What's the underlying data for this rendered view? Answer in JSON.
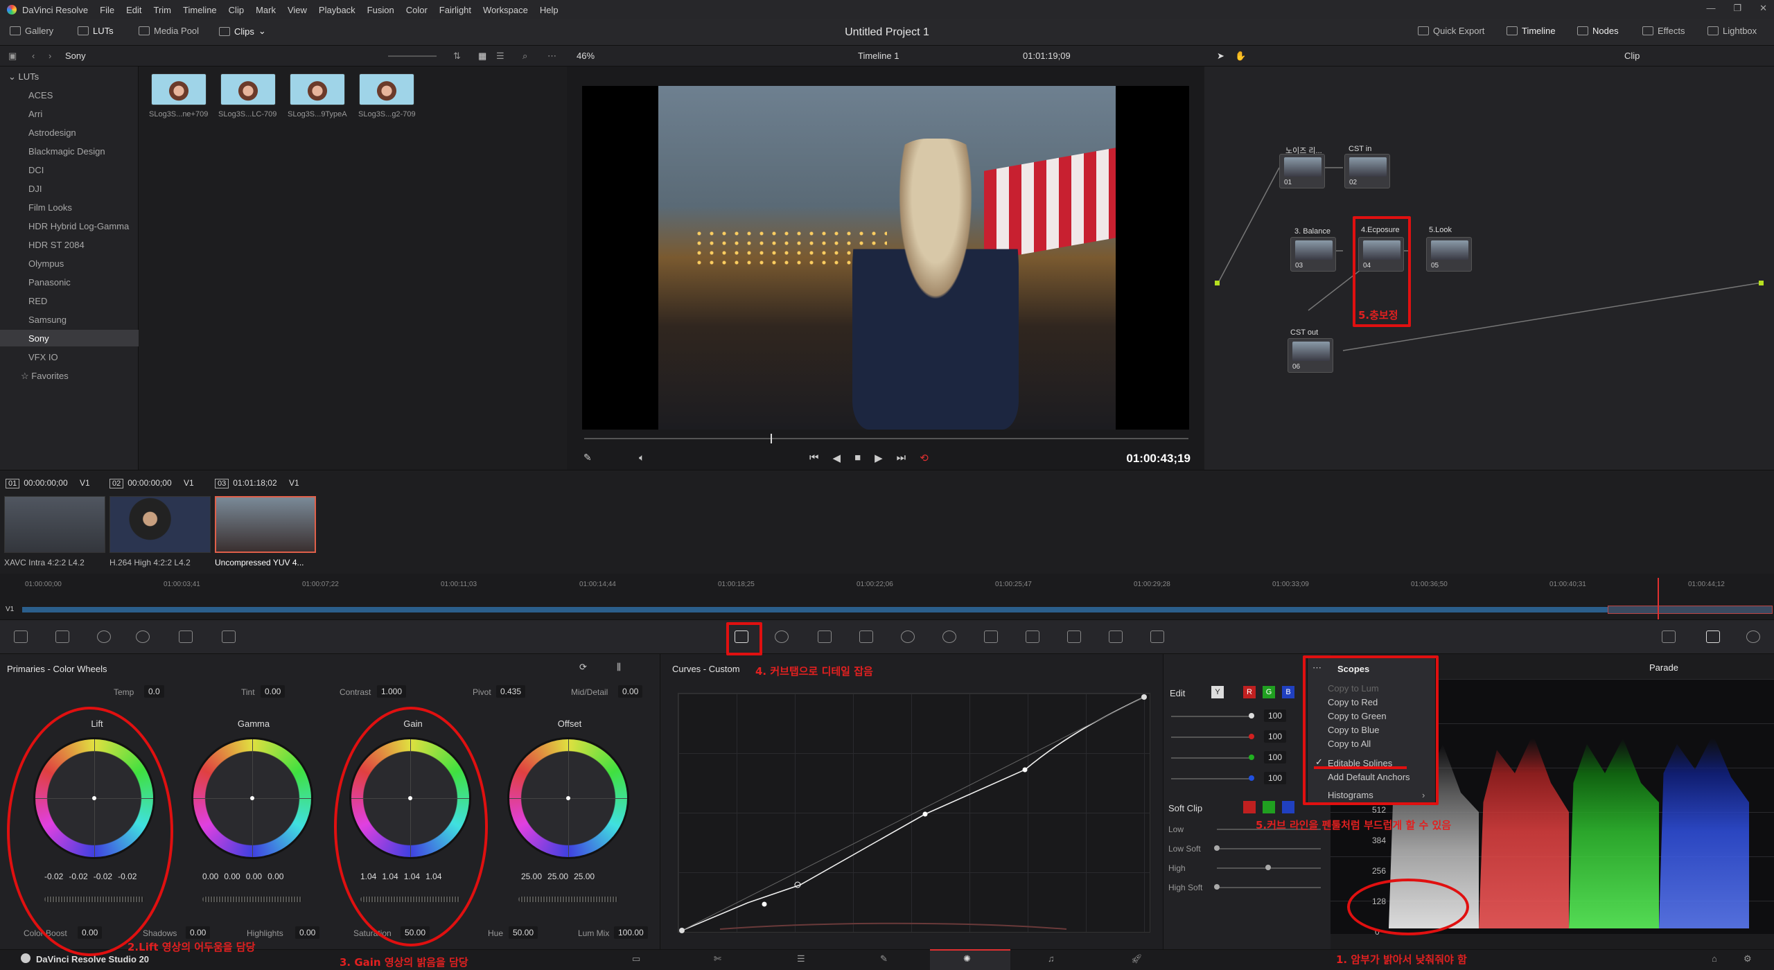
{
  "menubar": {
    "app": "DaVinci Resolve",
    "items": [
      "File",
      "Edit",
      "Trim",
      "Timeline",
      "Clip",
      "Mark",
      "View",
      "Playback",
      "Fusion",
      "Color",
      "Fairlight",
      "Workspace",
      "Help"
    ]
  },
  "topbar": {
    "gallery": "Gallery",
    "luts": "LUTs",
    "media_pool": "Media Pool",
    "clips": "Clips",
    "project_title": "Untitled Project 1",
    "quick_export": "Quick Export",
    "timeline": "Timeline",
    "nodes": "Nodes",
    "effects": "Effects",
    "lightbox": "Lightbox"
  },
  "subbar": {
    "folder": "Sony",
    "zoom": "46%",
    "timeline_name": "Timeline 1",
    "timecode": "01:01:19;09",
    "clip_mode": "Clip"
  },
  "lut_tree": {
    "root": "LUTs",
    "items": [
      "ACES",
      "Arri",
      "Astrodesign",
      "Blackmagic Design",
      "DCI",
      "DJI",
      "Film Looks",
      "HDR Hybrid Log-Gamma",
      "HDR ST 2084",
      "Olympus",
      "Panasonic",
      "RED",
      "Samsung",
      "Sony",
      "VFX IO"
    ],
    "favorites": "Favorites"
  },
  "lut_thumbs": [
    "SLog3S...ne+709",
    "SLog3S...LC-709",
    "SLog3S...9TypeA",
    "SLog3S...g2-709"
  ],
  "viewer": {
    "timecode": "01:00:43;19"
  },
  "nodes": [
    {
      "label": "노이즈 리...",
      "num": "01"
    },
    {
      "label": "CST in",
      "num": "02"
    },
    {
      "label": "3. Balance",
      "num": "03"
    },
    {
      "label": "4.Ecposure",
      "num": "04"
    },
    {
      "label": "5.Look",
      "num": "05"
    },
    {
      "label": "CST out",
      "num": "06"
    }
  ],
  "clips": [
    {
      "badge": "01",
      "tc": "00:00:00;00",
      "track": "V1",
      "name": "XAVC Intra 4:2:2 L4.2"
    },
    {
      "badge": "02",
      "tc": "00:00:00;00",
      "track": "V1",
      "name": "H.264 High 4:2:2 L4.2"
    },
    {
      "badge": "03",
      "tc": "01:01:18;02",
      "track": "V1",
      "name": "Uncompressed YUV 4..."
    }
  ],
  "ruler": [
    "01:00:00;00",
    "01:00:03;41",
    "01:00:07;22",
    "01:00:11;03",
    "01:00:14;44",
    "01:00:18;25",
    "01:00:22;06",
    "01:00:25;47",
    "01:00:29;28",
    "01:00:33;09",
    "01:00:36;50",
    "01:00:40;31",
    "01:00:44;12"
  ],
  "track_label": "V1",
  "primaries": {
    "title": "Primaries - Color Wheels",
    "temp_label": "Temp",
    "temp": "0.0",
    "tint_label": "Tint",
    "tint": "0.00",
    "contrast_label": "Contrast",
    "contrast": "1.000",
    "pivot_label": "Pivot",
    "pivot": "0.435",
    "mid_label": "Mid/Detail",
    "mid": "0.00",
    "wheels": [
      {
        "name": "Lift",
        "values": [
          "-0.02",
          "-0.02",
          "-0.02",
          "-0.02"
        ]
      },
      {
        "name": "Gamma",
        "values": [
          "0.00",
          "0.00",
          "0.00",
          "0.00"
        ]
      },
      {
        "name": "Gain",
        "values": [
          "1.04",
          "1.04",
          "1.04",
          "1.04"
        ]
      },
      {
        "name": "Offset",
        "values": [
          "25.00",
          "25.00",
          "25.00"
        ]
      }
    ],
    "color_boost_label": "Color Boost",
    "color_boost": "0.00",
    "shadows_label": "Shadows",
    "shadows": "0.00",
    "highlights_label": "Highlights",
    "highlights": "0.00",
    "saturation_label": "Saturation",
    "saturation": "50.00",
    "hue_label": "Hue",
    "hue": "50.00",
    "lummix_label": "Lum Mix",
    "lummix": "100.00"
  },
  "curves": {
    "title": "Curves - Custom",
    "edit_label": "Edit",
    "y": "Y",
    "r": "R",
    "g": "G",
    "b": "B",
    "values": [
      "100",
      "100",
      "100",
      "100"
    ],
    "soft_clip": "Soft Clip",
    "low": "Low",
    "low_soft": "Low Soft",
    "high": "High",
    "high_soft": "High Soft"
  },
  "scopes": {
    "title": "Scopes",
    "mode": "Parade",
    "ticks": [
      "512",
      "384",
      "256",
      "128",
      "0"
    ],
    "menu": [
      "Copy to Lum",
      "Copy to Red",
      "Copy to Green",
      "Copy to Blue",
      "Copy to All",
      "Editable Splines",
      "Add Default Anchors",
      "Histograms"
    ]
  },
  "bottombar": {
    "brand": "DaVinci Resolve Studio 20"
  },
  "annotations": {
    "a1": "1. 암부가 밝아서 낮춰줘야 함",
    "a2": "2.Lift 영상의 어두움을 담당",
    "a3": "3. Gain 영상의 밝음을 담당",
    "a4": "4. 커브탭으로 디테일 잡음",
    "a5": "5.커브 라인을 펜툴처럼 부드럽게 할 수 있음",
    "a6": "5.충보정"
  },
  "colors": {
    "accent_red": "#e01010",
    "track_blue": "#2b5f8c",
    "playhead": "#e03030"
  }
}
